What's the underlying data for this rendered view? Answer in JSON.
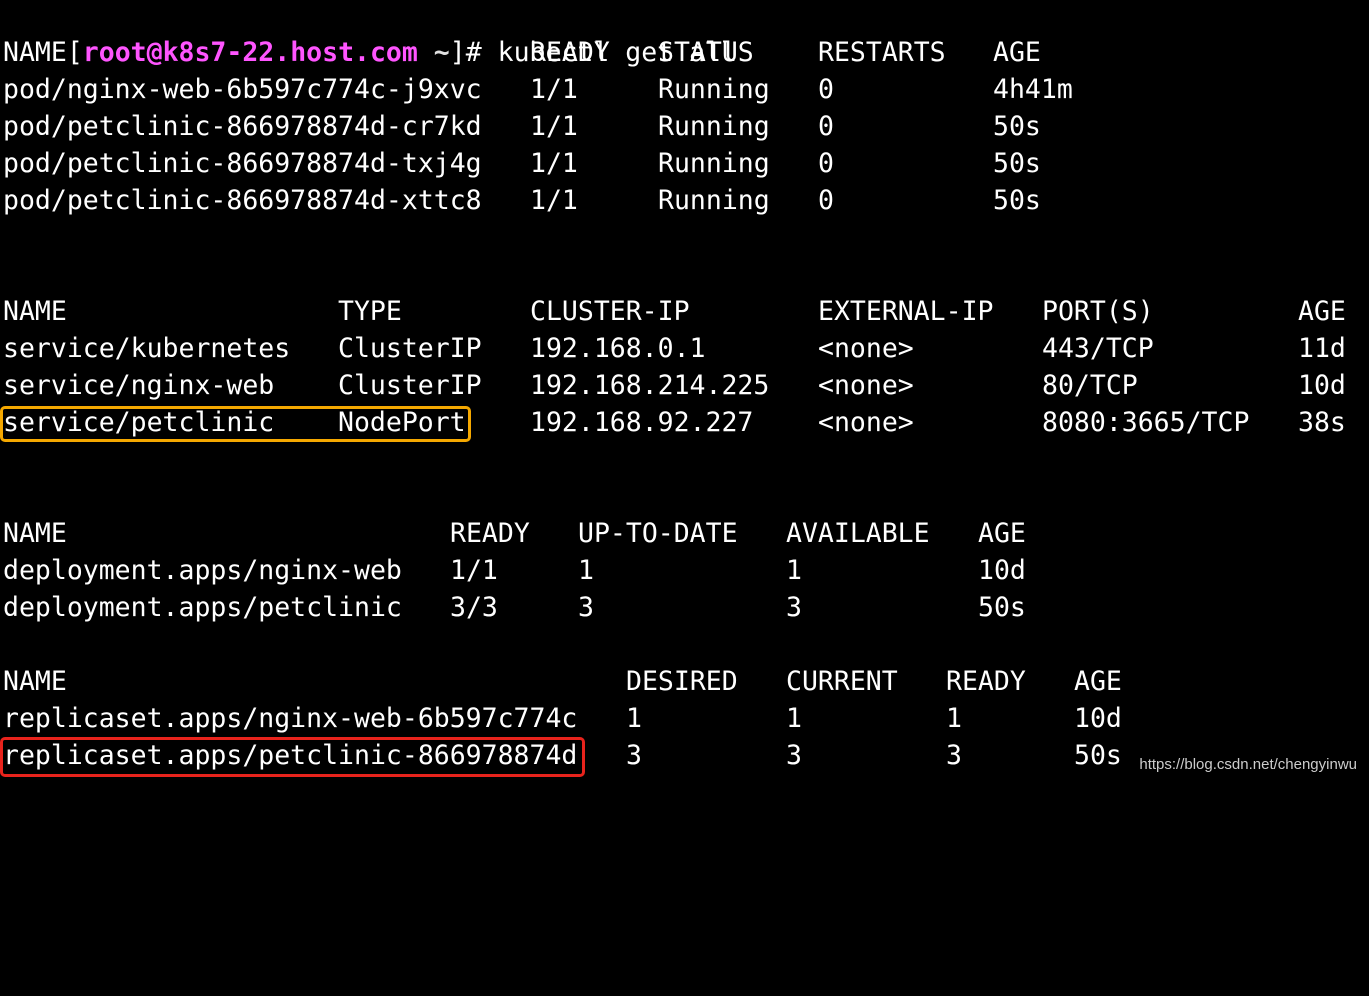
{
  "prompt": {
    "open_bracket": "[",
    "user_host": "root@k8s7-22.host.com",
    "tilde": " ~",
    "close": "]# ",
    "command": "kubectl get all",
    "user_color": "#ff55ff"
  },
  "pods": {
    "headers": [
      "NAME",
      "READY",
      "STATUS",
      "RESTARTS",
      "AGE"
    ],
    "rows": [
      [
        "pod/nginx-web-6b597c774c-j9xvc",
        "1/1",
        "Running",
        "0",
        "4h41m"
      ],
      [
        "pod/petclinic-866978874d-cr7kd",
        "1/1",
        "Running",
        "0",
        "50s"
      ],
      [
        "pod/petclinic-866978874d-txj4g",
        "1/1",
        "Running",
        "0",
        "50s"
      ],
      [
        "pod/petclinic-866978874d-xttc8",
        "1/1",
        "Running",
        "0",
        "50s"
      ]
    ]
  },
  "services": {
    "headers": [
      "NAME",
      "TYPE",
      "CLUSTER-IP",
      "EXTERNAL-IP",
      "PORT(S)",
      "AGE"
    ],
    "rows": [
      [
        "service/kubernetes",
        "ClusterIP",
        "192.168.0.1",
        "<none>",
        "443/TCP",
        "11d"
      ],
      [
        "service/nginx-web",
        "ClusterIP",
        "192.168.214.225",
        "<none>",
        "80/TCP",
        "10d"
      ],
      [
        "service/petclinic",
        "NodePort",
        "192.168.92.227",
        "<none>",
        "8080:3665/TCP",
        "38s"
      ]
    ]
  },
  "deployments": {
    "headers": [
      "NAME",
      "READY",
      "UP-TO-DATE",
      "AVAILABLE",
      "AGE"
    ],
    "rows": [
      [
        "deployment.apps/nginx-web",
        "1/1",
        "1",
        "1",
        "10d"
      ],
      [
        "deployment.apps/petclinic",
        "3/3",
        "3",
        "3",
        "50s"
      ]
    ]
  },
  "replicasets": {
    "headers": [
      "NAME",
      "DESIRED",
      "CURRENT",
      "READY",
      "AGE"
    ],
    "rows": [
      [
        "replicaset.apps/nginx-web-6b597c774c",
        "1",
        "1",
        "1",
        "10d"
      ],
      [
        "replicaset.apps/petclinic-866978874d",
        "3",
        "3",
        "3",
        "50s"
      ]
    ]
  },
  "highlights": {
    "service_color": "#f5a800",
    "replicaset_color": "#e8231c"
  },
  "watermark": "https://blog.csdn.net/chengyinwu"
}
